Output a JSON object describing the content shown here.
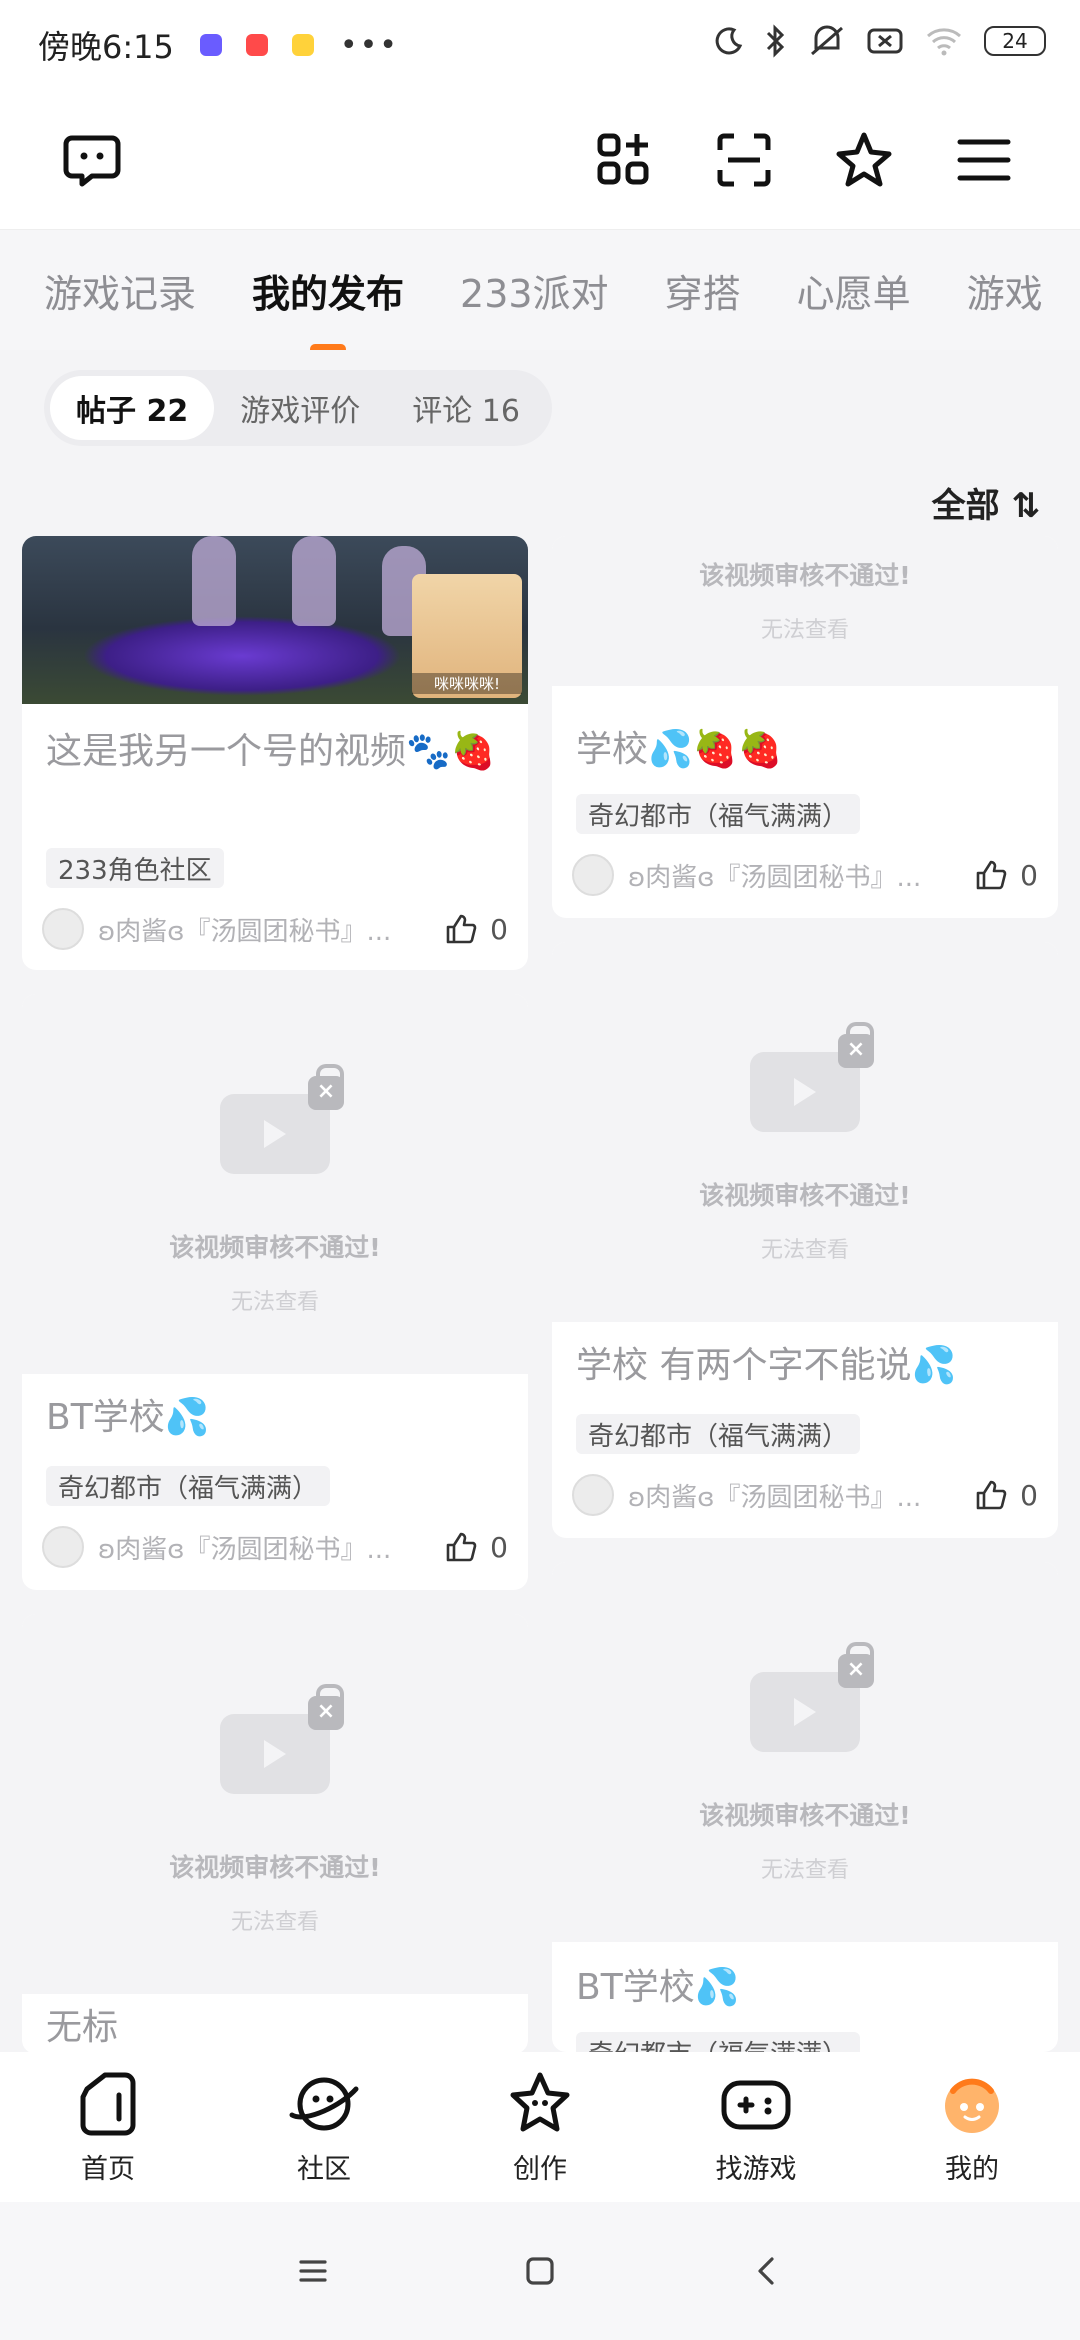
{
  "status_bar": {
    "time": "傍晚6:15",
    "dots": "•••",
    "battery": "24"
  },
  "header": {
    "icons": [
      "message-icon",
      "grid-add-icon",
      "scan-icon",
      "star-badge-icon",
      "menu-icon"
    ]
  },
  "tabs": [
    {
      "label": "游戏记录",
      "active": false
    },
    {
      "label": "我的发布",
      "active": true
    },
    {
      "label": "233派对",
      "active": false
    },
    {
      "label": "穿搭",
      "active": false
    },
    {
      "label": "心愿单",
      "active": false
    },
    {
      "label": "游戏",
      "active": false
    }
  ],
  "subtabs": [
    {
      "label": "帖子 22",
      "active": true
    },
    {
      "label": "游戏评价",
      "active": false
    },
    {
      "label": "评论 16",
      "active": false
    }
  ],
  "sort_label": "全部 ⇅",
  "blocked": {
    "title": "该视频审核不通过!",
    "sub": "无法查看"
  },
  "thumb_caption": "咪咪咪咪!",
  "posts": [
    {
      "title": "这是我另一个号的视频🐾🍓",
      "tag": "233角色社区",
      "author": "ʚ肉酱ɞ『汤圆团秘书』...",
      "likes": "0"
    },
    {
      "title": "学校💦🍓🍓",
      "tag": "奇幻都市（福气满满）",
      "author": "ʚ肉酱ɞ『汤圆团秘书』...",
      "likes": "0"
    },
    {
      "title": "BT学校💦",
      "tag": "奇幻都市（福气满满）",
      "author": "ʚ肉酱ɞ『汤圆团秘书』...",
      "likes": "0"
    },
    {
      "title": "学校 有两个字不能说💦",
      "tag": "奇幻都市（福气满满）",
      "author": "ʚ肉酱ɞ『汤圆团秘书』...",
      "likes": "0"
    },
    {
      "title": "无标",
      "tag": "",
      "author": "",
      "likes": ""
    },
    {
      "title": "BT学校💦",
      "tag": "奇幻都市（福气满满）",
      "author": "",
      "likes": ""
    }
  ],
  "bottom_nav": [
    {
      "label": "首页",
      "icon": "home-icon"
    },
    {
      "label": "社区",
      "icon": "planet-icon"
    },
    {
      "label": "创作",
      "icon": "star-create-icon"
    },
    {
      "label": "找游戏",
      "icon": "gamepad-icon"
    },
    {
      "label": "我的",
      "icon": "profile-avatar-icon"
    }
  ],
  "colors": {
    "accent": "#ff7a1a"
  }
}
